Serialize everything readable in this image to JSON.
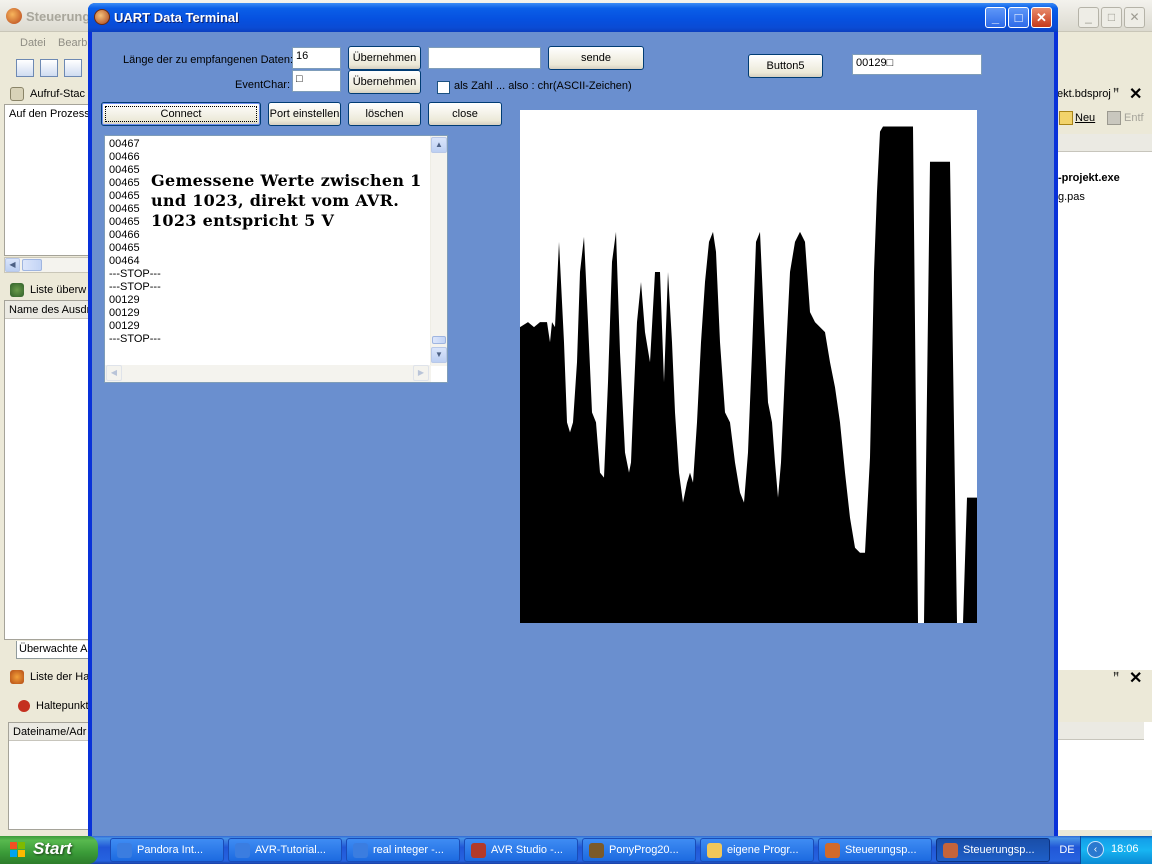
{
  "background_ide": {
    "title": "Steuerung",
    "menu": [
      "Datei",
      "Bearb"
    ],
    "left_panels": {
      "callstack_title": "Aufruf-Stac",
      "callstack_header": "Auf den Prozess",
      "watch_title": "Liste überw",
      "watch_header": "Name des Ausdr",
      "watch_tab": "Überwachte A",
      "breakpoints_title": "Liste der Ha",
      "breakpoints_button": "Haltepunkt",
      "breakpoints_header": "Dateiname/Adr"
    },
    "right_panels": {
      "project_title": "ekt.bdsproj",
      "new_label": "Neu",
      "remove_label": "Entf",
      "exe_name": "-projekt.exe",
      "pas_name": "g.pas"
    }
  },
  "dialog": {
    "title": "UART Data Terminal",
    "length_label": "Länge der zu empfangenen Daten:",
    "length_value": "16",
    "apply_label_1": "Übernehmen",
    "send_input_value": "",
    "send_label": "sende",
    "button5_label": "Button5",
    "value_display": "00129□",
    "eventchar_label": "EventChar:",
    "eventchar_value": "□",
    "apply_label_2": "Übernehmen",
    "as_number_label": "als Zahl",
    "also_label": "... also :  chr(ASCII-Zeichen)",
    "connect_label": "Connect",
    "port_label": "Port einstellen",
    "clear_label": "löschen",
    "close_label": "close",
    "memo_lines": [
      "00467",
      "00466",
      "00465",
      "00465",
      "00465",
      "00465",
      "00465",
      "00466",
      "00465",
      "00464",
      "---STOP---",
      "---STOP---",
      "00129",
      "00129",
      "00129",
      "---STOP---"
    ],
    "memo_note": "Gemessene Werte zwischen 1 und  1023, direkt vom AVR. 1023 entspricht 5 V"
  },
  "taskbar": {
    "start_label": "Start",
    "tasks": [
      "Pandora Int...",
      "AVR-Tutorial...",
      "real integer -...",
      "AVR Studio -...",
      "PonyProg20...",
      "eigene Progr...",
      "Steuerungsp...",
      "Steuerungsp..."
    ],
    "lang": "DE",
    "clock": "18:06"
  },
  "chart_data": {
    "type": "area",
    "title": "",
    "xlabel": "",
    "ylabel": "",
    "ylim": [
      0,
      1023
    ],
    "fill_color": "#000000",
    "background_color": "#ffffff",
    "x": [
      0,
      8,
      14,
      20,
      27,
      30,
      32,
      35,
      39,
      44,
      47,
      50,
      53,
      57,
      60,
      64,
      68,
      72,
      76,
      80,
      84,
      88,
      92,
      96,
      100,
      105,
      109,
      111,
      113,
      117,
      121,
      125,
      130,
      135,
      140,
      144,
      148,
      152,
      155,
      159,
      163,
      167,
      170,
      173,
      177,
      181,
      185,
      189,
      193,
      196,
      200,
      205,
      210,
      215,
      220,
      224,
      228,
      232,
      236,
      240,
      244,
      248,
      252,
      255,
      258,
      261,
      265,
      270,
      275,
      280,
      285,
      290,
      295,
      300,
      305,
      310,
      315,
      320,
      325,
      330,
      335,
      340,
      345,
      350,
      354,
      357,
      360,
      363,
      366,
      370,
      374,
      377,
      380,
      384,
      389,
      393,
      398,
      404,
      410,
      412,
      415,
      418,
      422,
      426,
      430,
      437,
      440,
      443,
      447,
      450,
      457
    ],
    "values": [
      590,
      600,
      590,
      600,
      600,
      560,
      600,
      590,
      760,
      560,
      400,
      380,
      400,
      520,
      700,
      770,
      600,
      420,
      400,
      300,
      290,
      480,
      720,
      780,
      540,
      340,
      300,
      320,
      420,
      600,
      680,
      580,
      520,
      700,
      700,
      480,
      700,
      560,
      420,
      300,
      240,
      280,
      300,
      280,
      400,
      560,
      680,
      760,
      780,
      740,
      560,
      420,
      400,
      320,
      260,
      240,
      340,
      540,
      760,
      780,
      600,
      440,
      400,
      320,
      250,
      320,
      500,
      700,
      760,
      780,
      760,
      620,
      600,
      590,
      580,
      520,
      470,
      400,
      300,
      210,
      150,
      140,
      140,
      330,
      700,
      860,
      980,
      990,
      990,
      990,
      990,
      990,
      990,
      990,
      990,
      990,
      0,
      0,
      920,
      920,
      920,
      920,
      920,
      920,
      920,
      0,
      0,
      0,
      250,
      250,
      250
    ]
  }
}
